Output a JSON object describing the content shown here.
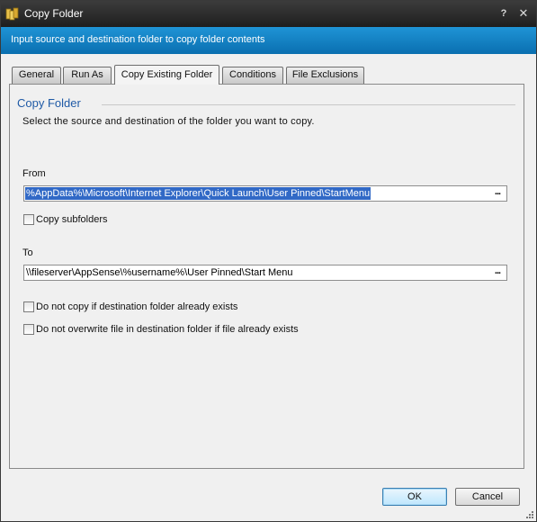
{
  "window": {
    "title": "Copy Folder",
    "help_glyph": "?",
    "close_glyph": "✕",
    "icon": "folder-copy-icon",
    "banner_text": "Input source and destination folder to copy folder contents",
    "banner_color": "#1584c6"
  },
  "tabs": [
    {
      "label": "General",
      "active": false
    },
    {
      "label": "Run As",
      "active": false
    },
    {
      "label": "Copy Existing Folder",
      "active": true
    },
    {
      "label": "Conditions",
      "active": false
    },
    {
      "label": "File Exclusions",
      "active": false
    }
  ],
  "section": {
    "title": "Copy Folder",
    "description": "Select the source and destination of the folder you want to copy."
  },
  "from": {
    "label": "From",
    "value": "%AppData%\\Microsoft\\Internet Explorer\\Quick Launch\\User Pinned\\StartMenu",
    "browse_label": "..."
  },
  "copy_subfolders": {
    "label": "Copy subfolders",
    "checked": false
  },
  "to": {
    "label": "To",
    "value": "\\\\fileserver\\AppSense\\%username%\\User Pinned\\Start Menu",
    "browse_label": "..."
  },
  "options": [
    {
      "label": "Do not copy if destination folder already exists",
      "checked": false
    },
    {
      "label": "Do not overwrite file in destination folder if file already exists",
      "checked": false
    }
  ],
  "buttons": {
    "ok": "OK",
    "cancel": "Cancel"
  },
  "colors": {
    "accent": "#1f5aa6",
    "selection": "#3169c6",
    "titlebar": "#2b2b2b"
  }
}
